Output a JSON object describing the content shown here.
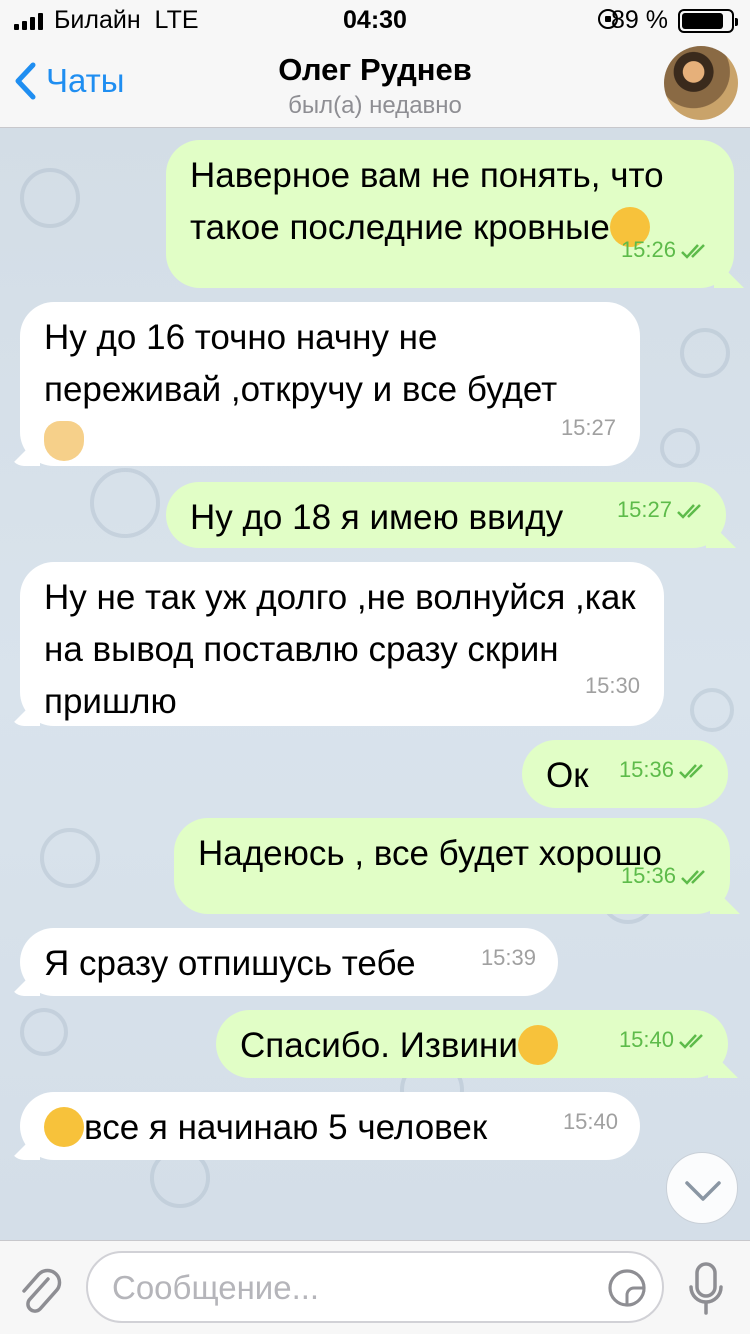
{
  "status_bar": {
    "carrier": "Билайн",
    "network": "LTE",
    "time": "04:30",
    "battery_percent": "89 %"
  },
  "header": {
    "back_label": "Чаты",
    "contact_name": "Олег Руднев",
    "contact_status": "был(а) недавно"
  },
  "messages": [
    {
      "dir": "out",
      "text": "Наверное вам не понять, что такое последние кровные",
      "emoji": "face-with-hand-over-mouth",
      "time": "15:26"
    },
    {
      "dir": "in",
      "text": "Ну до 16 точно начну не переживай ,откручу и все будет",
      "emoji": "ok-hand",
      "time": "15:27"
    },
    {
      "dir": "out",
      "text": "Ну до 18 я имею ввиду",
      "time": "15:27"
    },
    {
      "dir": "in",
      "text": "Ну не так уж долго ,не волнуйся ,как на вывод поставлю сразу скрин пришлю",
      "time": "15:30"
    },
    {
      "dir": "out",
      "text": "Ок",
      "time": "15:36"
    },
    {
      "dir": "out",
      "text": "Надеюсь , все будет хорошо",
      "time": "15:36"
    },
    {
      "dir": "in",
      "text": "Я сразу отпишусь тебе",
      "time": "15:39"
    },
    {
      "dir": "out",
      "text": "Спасибо. Извини",
      "emoji": "upside-down-face",
      "time": "15:40"
    },
    {
      "dir": "in",
      "text": "все я начинаю 5 человек",
      "emoji": "smiling-face",
      "time": "15:40"
    }
  ],
  "composer": {
    "placeholder": "Сообщение..."
  },
  "colors": {
    "accent": "#1f8ef1",
    "outgoing_bubble": "#e1fec6",
    "incoming_bubble": "#ffffff",
    "read_ticks": "#5dbb4a"
  }
}
